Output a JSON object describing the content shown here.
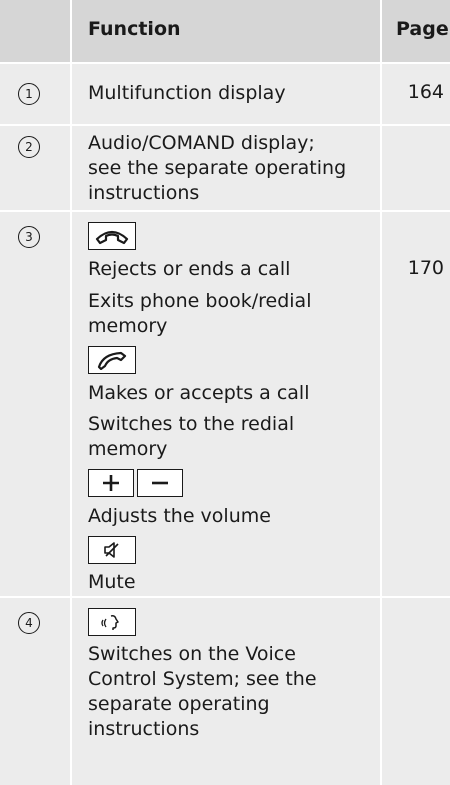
{
  "header": {
    "function": "Function",
    "page": "Page"
  },
  "rows": [
    {
      "num": "1",
      "lines": [
        "Multifunction display"
      ],
      "page": "164"
    },
    {
      "num": "2",
      "lines": [
        "Audio/COMAND display;",
        "see the separate operating",
        "instructions"
      ],
      "page": ""
    },
    {
      "num": "3",
      "lines": [
        "Rejects or ends a call",
        "Exits phone book/redial",
        "memory",
        "Makes or accepts a call",
        "Switches to the redial",
        "memory",
        "Adjusts the volume",
        "Mute"
      ],
      "page": "170"
    },
    {
      "num": "4",
      "lines": [
        "Switches on the Voice",
        "Control System; see the",
        "separate operating",
        "instructions"
      ],
      "page": ""
    }
  ],
  "icons": [
    "end-call-icon",
    "accept-call-icon",
    "volume-up-icon",
    "volume-down-icon",
    "mute-icon",
    "voice-control-icon"
  ]
}
